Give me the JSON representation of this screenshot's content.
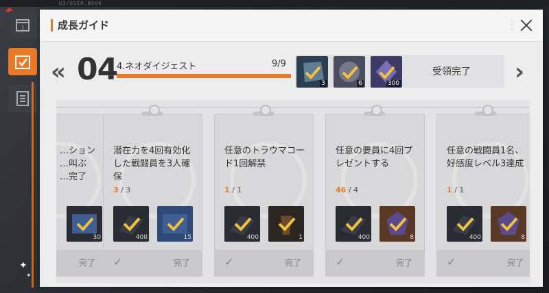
{
  "top_code": "UI/USER.BOOK",
  "dialog": {
    "title": "成長ガイド"
  },
  "stage": {
    "number": "04",
    "name": "4.ネオダイジェスト",
    "progress": "9/9",
    "progress_fraction": 1.0,
    "claim_label": "受領完了",
    "rewards": [
      {
        "icon": "rock-check-icon",
        "count": "3",
        "color": "#2b3e52"
      },
      {
        "icon": "crystal-check-icon",
        "count": "6",
        "color": "#4a4d5e"
      },
      {
        "icon": "shard-check-icon",
        "count": "300",
        "color": "#3e3a66"
      }
    ]
  },
  "cards": [
    {
      "text": "…ション\n…叫ぶ\n…完了",
      "progress_done": "",
      "progress_total": "",
      "items": [
        {
          "icon": "ticket-check-icon",
          "count": "30"
        }
      ],
      "done_label": "完了"
    },
    {
      "text": "潜在力を4回有効化した戦闘員を3人確保",
      "progress_done": "3",
      "progress_total": "/ 3",
      "items": [
        {
          "icon": "book-check-icon",
          "count": "400"
        },
        {
          "icon": "ticket-check-icon",
          "count": "15"
        }
      ],
      "done_label": "完了"
    },
    {
      "text": "任意のトラウマコード1回解禁",
      "progress_done": "1",
      "progress_total": "/ 1",
      "items": [
        {
          "icon": "book-check-icon",
          "count": "400"
        },
        {
          "icon": "drink-check-icon",
          "count": "1"
        }
      ],
      "done_label": "完了"
    },
    {
      "text": "任意の要員に4回プレゼントする",
      "progress_done": "46",
      "progress_total": "/ 4",
      "items": [
        {
          "icon": "book-check-icon",
          "count": "400"
        },
        {
          "icon": "gem-check-icon",
          "count": "8"
        }
      ],
      "done_label": "完了"
    },
    {
      "text": "任意の戦闘員1名、好感度レベル3達成",
      "progress_done": "1",
      "progress_total": "/ 1",
      "items": [
        {
          "icon": "book-check-icon",
          "count": "400"
        },
        {
          "icon": "gem-check-icon",
          "count": "8"
        }
      ],
      "done_label": "完了"
    }
  ]
}
